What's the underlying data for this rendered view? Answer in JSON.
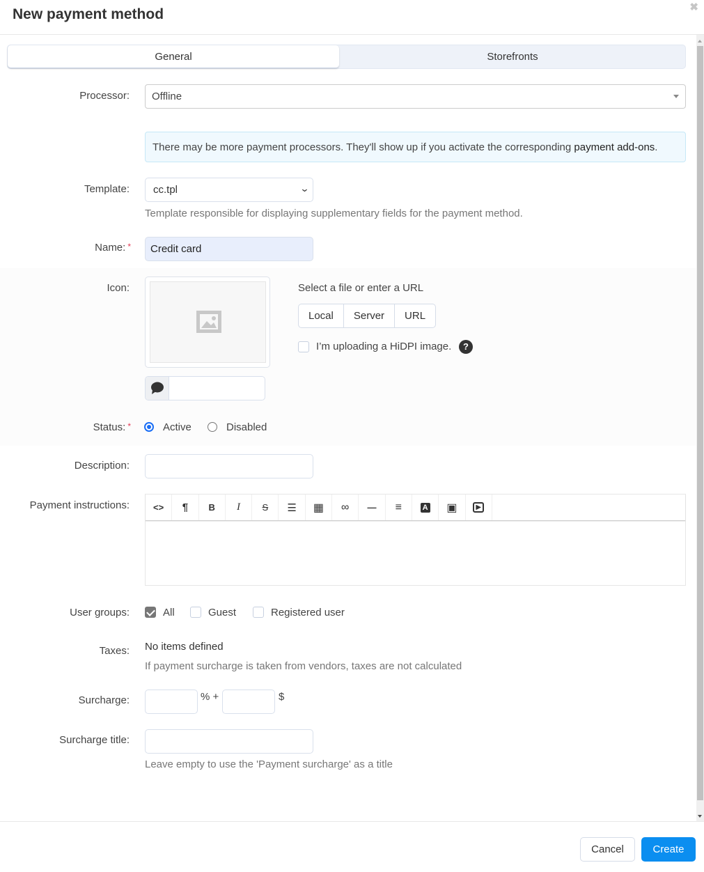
{
  "dialog": {
    "title": "New payment method",
    "close_glyph": "✖"
  },
  "tabs": [
    {
      "label": "General",
      "active": true
    },
    {
      "label": "Storefronts",
      "active": false
    }
  ],
  "form": {
    "processor": {
      "label": "Processor:",
      "value": "Offline"
    },
    "notice": {
      "text": "There may be more payment processors. They'll show up if you activate the corresponding ",
      "link": "payment add-ons",
      "suffix": "."
    },
    "template": {
      "label": "Template:",
      "value": "cc.tpl",
      "help": "Template responsible for displaying supplementary fields for the payment method."
    },
    "name": {
      "label": "Name:",
      "required_mark": "*",
      "value": "Credit card"
    },
    "icon": {
      "label": "Icon:",
      "upload_title": "Select a file or enter a URL",
      "sources": [
        "Local",
        "Server",
        "URL"
      ],
      "hidpi_label": "I’m uploading a HiDPI image.",
      "hidpi_checked": false,
      "help_glyph": "?",
      "alt_value": ""
    },
    "status": {
      "label": "Status:",
      "required_mark": "*",
      "options": [
        {
          "label": "Active",
          "checked": true
        },
        {
          "label": "Disabled",
          "checked": false
        }
      ]
    },
    "description": {
      "label": "Description:",
      "value": ""
    },
    "payment_instructions": {
      "label": "Payment instructions:",
      "toolbar": [
        {
          "name": "html-code",
          "glyph": "<>"
        },
        {
          "name": "paragraph",
          "glyph": "¶"
        },
        {
          "name": "bold",
          "glyph": "B"
        },
        {
          "name": "italic",
          "glyph": "I"
        },
        {
          "name": "strikethrough",
          "glyph": "S"
        },
        {
          "name": "unordered-list",
          "glyph": "☰"
        },
        {
          "name": "table",
          "glyph": "▦"
        },
        {
          "name": "link",
          "glyph": "∞"
        },
        {
          "name": "horizontal-rule",
          "glyph": "—"
        },
        {
          "name": "align",
          "glyph": "≡"
        },
        {
          "name": "font-color",
          "glyph": "A"
        },
        {
          "name": "image",
          "glyph": "▣"
        },
        {
          "name": "video",
          "glyph": "▶"
        }
      ],
      "value": ""
    },
    "user_groups": {
      "label": "User groups:",
      "options": [
        {
          "label": "All",
          "checked": true
        },
        {
          "label": "Guest",
          "checked": false
        },
        {
          "label": "Registered user",
          "checked": false
        }
      ]
    },
    "taxes": {
      "label": "Taxes:",
      "value": "No items defined",
      "help": "If payment surcharge is taken from vendors, taxes are not calculated"
    },
    "surcharge": {
      "label": "Surcharge:",
      "percent_value": "",
      "percent_suffix": "% +",
      "fixed_value": "",
      "currency": "$"
    },
    "surcharge_title": {
      "label": "Surcharge title:",
      "value": "",
      "help": "Leave empty to use the 'Payment surcharge' as a title"
    }
  },
  "footer": {
    "cancel_label": "Cancel",
    "create_label": "Create"
  },
  "colors": {
    "primary": "#0b8ef0",
    "required": "#e53954",
    "radio_active": "#1a6ef5",
    "name_field_bg": "#e8eefc",
    "notice_bg": "#f0f9fe"
  }
}
